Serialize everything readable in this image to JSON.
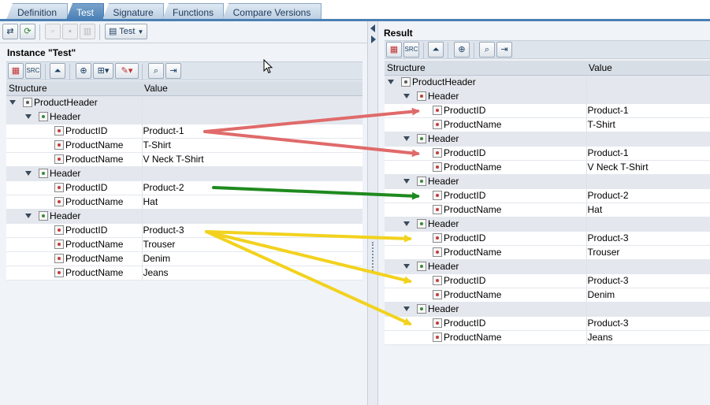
{
  "tabs": [
    {
      "label": "Definition"
    },
    {
      "label": "Test"
    },
    {
      "label": "Signature"
    },
    {
      "label": "Functions"
    },
    {
      "label": "Compare Versions"
    }
  ],
  "toolbar": {
    "test_dropdown_label": "Test"
  },
  "instance": {
    "title": "Instance \"Test\"",
    "col_structure": "Structure",
    "col_value": "Value",
    "rows": [
      {
        "name": "ProductHeader",
        "value": ""
      },
      {
        "name": "Header",
        "value": ""
      },
      {
        "name": "ProductID",
        "value": "Product-1"
      },
      {
        "name": "ProductName",
        "value": "T-Shirt"
      },
      {
        "name": "ProductName",
        "value": "V Neck T-Shirt"
      },
      {
        "name": "Header",
        "value": ""
      },
      {
        "name": "ProductID",
        "value": "Product-2"
      },
      {
        "name": "ProductName",
        "value": "Hat"
      },
      {
        "name": "Header",
        "value": ""
      },
      {
        "name": "ProductID",
        "value": "Product-3"
      },
      {
        "name": "ProductName",
        "value": "Trouser"
      },
      {
        "name": "ProductName",
        "value": "Denim"
      },
      {
        "name": "ProductName",
        "value": "Jeans"
      }
    ]
  },
  "result": {
    "title": "Result",
    "col_structure": "Structure",
    "col_value": "Value",
    "rows": [
      {
        "name": "ProductHeader",
        "value": ""
      },
      {
        "name": "Header",
        "value": ""
      },
      {
        "name": "ProductID",
        "value": "Product-1"
      },
      {
        "name": "ProductName",
        "value": "T-Shirt"
      },
      {
        "name": "Header",
        "value": ""
      },
      {
        "name": "ProductID",
        "value": "Product-1"
      },
      {
        "name": "ProductName",
        "value": "V Neck T-Shirt"
      },
      {
        "name": "Header",
        "value": ""
      },
      {
        "name": "ProductID",
        "value": "Product-2"
      },
      {
        "name": "ProductName",
        "value": "Hat"
      },
      {
        "name": "Header",
        "value": ""
      },
      {
        "name": "ProductID",
        "value": "Product-3"
      },
      {
        "name": "ProductName",
        "value": "Trouser"
      },
      {
        "name": "Header",
        "value": ""
      },
      {
        "name": "ProductID",
        "value": "Product-3"
      },
      {
        "name": "ProductName",
        "value": "Denim"
      },
      {
        "name": "Header",
        "value": ""
      },
      {
        "name": "ProductID",
        "value": "Product-3"
      },
      {
        "name": "ProductName",
        "value": "Jeans"
      }
    ]
  },
  "colors": {
    "arrow_red": "#e06a6a",
    "arrow_green": "#1e8a1e",
    "arrow_yellow": "#f2d21e",
    "tab_active": "#4a80b4"
  }
}
